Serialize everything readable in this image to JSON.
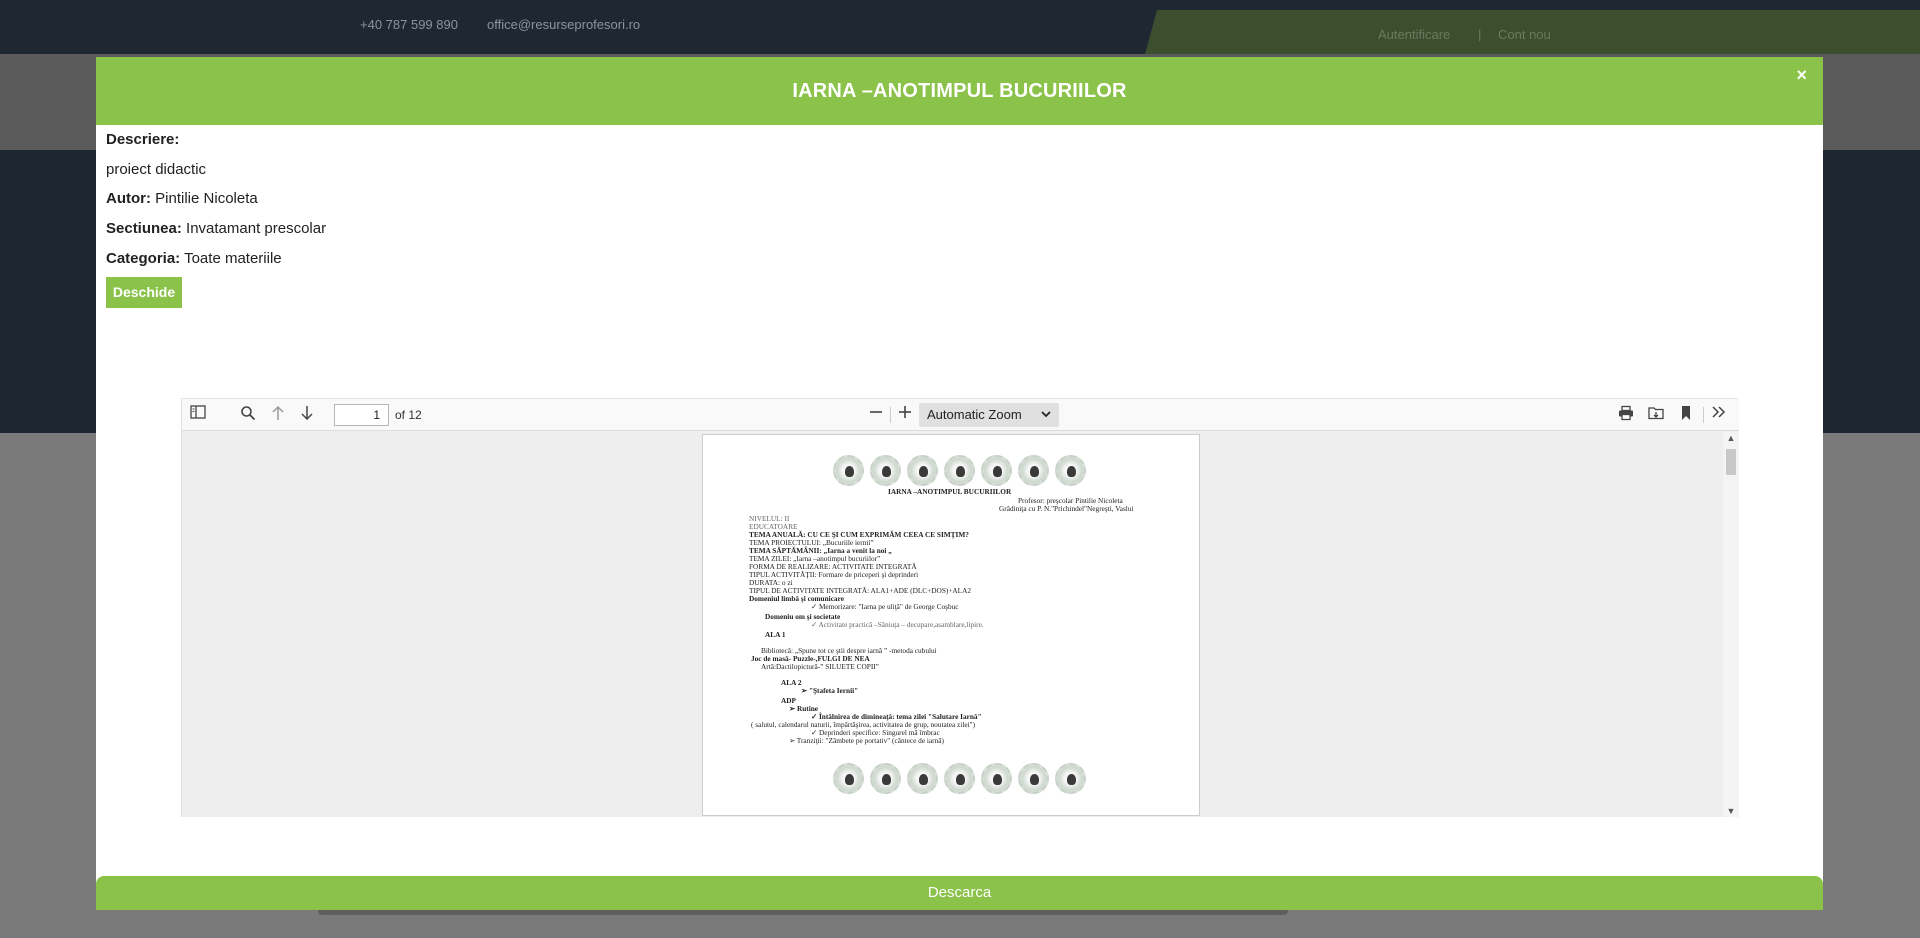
{
  "topbar": {
    "phone": "+40 787 599 890",
    "email": "office@resurseprofesori.ro",
    "login": "Autentificare",
    "separator": "|",
    "register": "Cont nou"
  },
  "modal": {
    "title": "IARNA –ANOTIMPUL BUCURIILOR",
    "close": "×",
    "description_label": "Descriere:",
    "description": "proiect didactic",
    "author_label": "Autor:",
    "author": "Pintilie Nicoleta",
    "section_label": "Sectiunea:",
    "section": "Invatamant prescolar",
    "category_label": "Categoria:",
    "category": "Toate materiile",
    "open_button": "Deschide",
    "download_button": "Descarca"
  },
  "viewer": {
    "page_number": "1",
    "page_total": "of 12",
    "zoom": "Automatic Zoom",
    "icons": [
      "sidebar-toggle-icon",
      "search-icon",
      "arrow-up-icon",
      "arrow-down-icon",
      "zoom-out-icon",
      "zoom-in-icon",
      "print-icon",
      "open-file-icon",
      "bookmark-icon",
      "double-chevron-right-icon"
    ]
  },
  "document": {
    "title": "IARNA –ANOTIMPUL BUCURIILOR",
    "lines": [
      "Profesor: preşcolar Pintilie Nicoleta",
      "Grădiniţa cu P. N.\"Prichindel\"Negreşti, Vaslui",
      "NIVELUL: II",
      "EDUCATOARE",
      "TEMA ANUALĂ: CU CE ŞI CUM EXPRIMĂM CEEA CE SIMŢIM?",
      "TEMA PROIECTULUI: „Bucuriile iernii”",
      "TEMA SĂPTĂMÂNII: „Iarna a venit la noi „",
      "TEMA ZILEI: „Iarna –anotimpul bucuriilor”",
      "FORMA DE REALIZARE: ACTIVITATE INTEGRATĂ",
      "TIPUL ACTIVITĂŢII: Formare de priceperi şi deprinderi",
      "DURATA: o zi",
      "TIPUL DE ACTIVITATE INTEGRATĂ: ALA1+ADE (DLC+DOS)+ALA2",
      "Domeniul limbă şi comunicare",
      "✓   Memorizare: \"Iarna pe uliţă\" de George Coşbuc",
      "Domeniu om şi societate",
      "✓   Activitate practică –Săniuţa – decupare,asamblare,lipire.",
      "ALA 1",
      "Bibliotecă: „Spune tot ce ştii despre iarnă ” -metoda cubului",
      "Joc de masă- Puzzle-,FULGI DE NEA",
      "Artă:Dactilopictură-” SILUETE COPII”",
      "ALA 2",
      "➢   \"Ştafeta Iernii\"",
      "ADP",
      "➢   Rutine",
      "✓   Întâlnirea de dimineaţă: tema zilei \"Salutare Iarnă\"",
      "( salutul, calendarul naturii, împărtăşirea, activitatea de grup, noutatea zilei\")",
      "✓   Deprinderi specifice: Singurel mă îmbrac",
      "➢   Tranziţii: \"Zâmbete pe portativ\" (cântece de iarnă)"
    ]
  },
  "colors": {
    "accent": "#8bc24a",
    "dark": "#1f2733"
  }
}
